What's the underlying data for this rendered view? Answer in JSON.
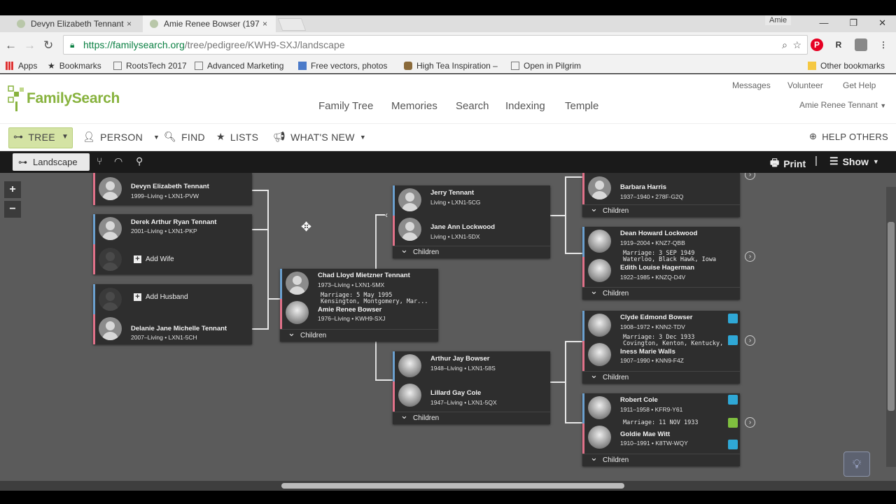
{
  "browser": {
    "tabs": [
      {
        "title": "Devyn Elizabeth Tennant",
        "close": "×"
      },
      {
        "title": "Amie Renee Bowser (197",
        "close": "×"
      }
    ],
    "profile_name": "Amie",
    "url_host": "https://familysearch.org",
    "url_path": "/tree/pedigree/KWH9-SXJ/landscape",
    "bookmarks": [
      {
        "label": "Apps",
        "icon": "apps-grid-icon"
      },
      {
        "label": "Bookmarks",
        "icon": "star-icon"
      },
      {
        "label": "RootsTech 2017",
        "icon": "page-icon"
      },
      {
        "label": "Advanced Marketing",
        "icon": "page-icon"
      },
      {
        "label": "Free vectors, photos",
        "icon": "image-icon"
      },
      {
        "label": "High Tea Inspiration –",
        "icon": "teacup-icon"
      },
      {
        "label": "Open in Pilgrim",
        "icon": "page-icon"
      }
    ],
    "other_bookmarks": "Other bookmarks"
  },
  "header": {
    "logo": "FamilySearch",
    "nav": [
      "Family Tree",
      "Memories",
      "Search",
      "Indexing",
      "Temple"
    ],
    "utility": [
      "Messages",
      "Volunteer",
      "Get Help"
    ],
    "user": "Amie Renee Tennant"
  },
  "subnav": {
    "tree": "TREE",
    "person": "PERSON",
    "find": "FIND",
    "lists": "LISTS",
    "whats_new": "WHAT'S NEW",
    "help_others": "HELP OTHERS"
  },
  "toolbar": {
    "view": "Landscape",
    "print": "Print",
    "show": "Show"
  },
  "zoom": {
    "in": "+",
    "out": "−"
  },
  "tree": {
    "children": {
      "c1": {
        "name": "Devyn Elizabeth Tennant",
        "dates": "1999–Living • LXN1-PVW"
      },
      "c2": {
        "name": "Derek Arthur Ryan Tennant",
        "dates": "2001–Living • LXN1-PKP",
        "add": "Add Wife"
      },
      "c3": {
        "add": "Add Husband",
        "name": "Delanie Jane Michelle Tennant",
        "dates": "2007–Living • LXN1-5CH"
      }
    },
    "focus": {
      "husband": "Chad Lloyd Mietzner Tennant",
      "husband_dates": "1973–Living • LXN1-5MX",
      "marriage1": "Marriage: 5 May 1995",
      "marriage2": "Kensington, Montgomery, Mar...",
      "wife": "Amie Renee Bowser",
      "wife_dates": "1976–Living • KWH9-SXJ",
      "children": "Children"
    },
    "parents1": {
      "husband": "Jerry Tennant",
      "husband_dates": "Living • LXN1-5CG",
      "wife": "Jane Ann Lockwood",
      "wife_dates": "Living • LXN1-5DX",
      "children": "Children"
    },
    "parents2": {
      "husband": "Arthur Jay Bowser",
      "husband_dates": "1948–Living • LXN1-58S",
      "wife": "Lillard Gay Cole",
      "wife_dates": "1947–Living • LXN1-5QX",
      "children": "Children"
    },
    "gp1": {
      "person": "Barbara Harris",
      "dates": "1937–1940 • 278F-G2Q",
      "children": "Children"
    },
    "gp2": {
      "husband": "Dean Howard Lockwood",
      "husband_dates": "1919–2004 • KNZ7-QBB",
      "marriage1": "Marriage: 3 SEP 1949",
      "marriage2": "Waterloo, Black Hawk, Iowa",
      "wife": "Edith Louise Hagerman",
      "wife_dates": "1922–1985 • KNZQ-D4V",
      "children": "Children"
    },
    "gp3": {
      "husband": "Clyde Edmond Bowser",
      "husband_dates": "1908–1972 • KNN2-TDV",
      "marriage1": "Marriage: 3 Dec 1933",
      "marriage2": "Covington, Kenton, Kentucky, ...",
      "wife": "Iness Marie Walls",
      "wife_dates": "1907–1990 • KNN9-F4Z",
      "children": "Children"
    },
    "gp4": {
      "husband": "Robert Cole",
      "husband_dates": "1911–1958 • KFR9-Y61",
      "marriage1": "Marriage: 11 NOV 1933",
      "wife": "Goldie Mae Witt",
      "wife_dates": "1910–1991 • K8TW-WQY",
      "children": "Children"
    }
  },
  "colors": {
    "male_accent": "#6ba0cf",
    "female_accent": "#e17189",
    "brand_green": "#87b23d",
    "record_blue": "#2fa8d6",
    "record_green": "#7fbf3f"
  }
}
